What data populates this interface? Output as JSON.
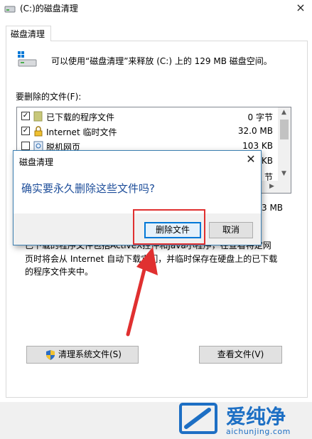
{
  "window": {
    "title": "(C:)的磁盘清理",
    "close_glyph": "×",
    "tab_label": "磁盘清理"
  },
  "main": {
    "summary": "可以使用“磁盘清理”来释放 (C:) 上的 129 MB 磁盘空间。",
    "files_label": "要删除的文件(F):",
    "file_list": [
      {
        "checked": true,
        "name": "已下载的程序文件",
        "size": "0 字节",
        "icon": "folder-icon"
      },
      {
        "checked": true,
        "name": "Internet 临时文件",
        "size": "32.0 MB",
        "icon": "lock-icon"
      },
      {
        "checked": false,
        "name": "脱机网页",
        "size": "103 KB",
        "icon": "offline-page-icon"
      }
    ],
    "partial_sizes": [
      "KB",
      "节"
    ],
    "total_partial": "3 MB",
    "description": {
      "line1": "已下载的程序文件包括ActiveX控件和Java小程序，在查看特定网",
      "line2": "页时将会从 Internet 自动下载它们，并临时保存在硬盘上的已下载",
      "line3": "的程序文件夹中。"
    },
    "clean_system_button": "清理系统文件(S)",
    "view_files_button": "查看文件(V)"
  },
  "dialog": {
    "title": "磁盘清理",
    "close_glyph": "✕",
    "question": "确实要永久删除这些文件吗?",
    "delete_button": "删除文件",
    "cancel_button": "取消"
  },
  "watermark": {
    "brand": "爱纯净",
    "url": "aichunjing.com"
  },
  "colors": {
    "highlight": "#e03030",
    "dialog_text": "#1e4e9a",
    "watermark": "#1d6fc4",
    "accent": "#0078d7"
  }
}
